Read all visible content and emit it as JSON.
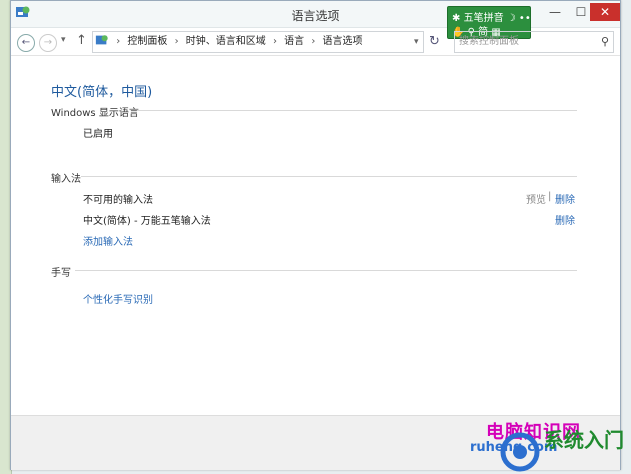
{
  "window": {
    "title": "语言选项"
  },
  "ime_toolbar": {
    "mode_label": "五笔拼音"
  },
  "nav": {
    "breadcrumbs": [
      "控制面板",
      "时钟、语言和区域",
      "语言",
      "语言选项"
    ],
    "search_placeholder": "搜索控制面板"
  },
  "main": {
    "page_title": "中文(简体，中国)",
    "display_language": {
      "heading": "Windows 显示语言",
      "status": "已启用"
    },
    "input_methods": {
      "heading": "输入法",
      "items": [
        {
          "label": "不可用的输入法",
          "preview_label": "预览",
          "remove_label": "删除"
        },
        {
          "label": "中文(简体) - 万能五笔输入法",
          "remove_label": "删除"
        }
      ],
      "add_label": "添加输入法"
    },
    "handwriting": {
      "heading": "手写",
      "link": "个性化手写识别"
    }
  },
  "watermark": {
    "line1": "电脑知识网",
    "line2": "ruheng.com",
    "line3": "系统入门"
  }
}
